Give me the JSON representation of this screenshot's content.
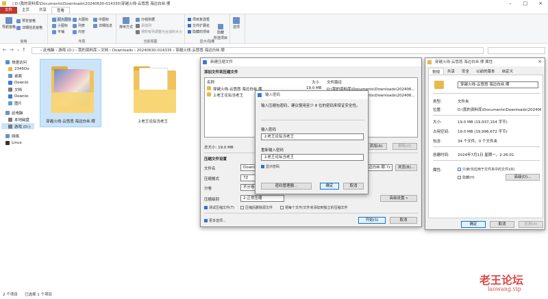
{
  "titlebar": {
    "title": "| D:\\我的资料库\\Documents\\Downloads\\20240630-014335\\穿越火线-云悠悠 海边白丝.哪"
  },
  "ribbon": {
    "tabs": [
      "文件",
      "主页",
      "共享",
      "查看"
    ],
    "groups": [
      {
        "label": "窗格",
        "items": [
          "导航窗格",
          "预览窗格",
          "详细信息窗格"
        ]
      },
      {
        "label": "布局",
        "items": [
          "超大图标",
          "大图标",
          "中图标",
          "小图标",
          "列表",
          "详细信息",
          "平铺",
          "内容"
        ]
      },
      {
        "label": "当前视图",
        "items": [
          "排序方式",
          "分组依据",
          "添加列",
          "将所有列调整为合适的大小"
        ]
      },
      {
        "label": "显示/隐藏",
        "items": [
          "项目复选框",
          "文件扩展名",
          "隐藏的项目",
          "隐藏",
          "所选项目"
        ]
      },
      {
        "label": "",
        "items": [
          "选项"
        ]
      }
    ]
  },
  "address": {
    "path": "› 此电脑 › 游戏 (D:) › 我的资料库 › 文档 › Downloads › 20240630-014335 › 穿越火线-云悠悠 海边白丝.哪"
  },
  "nav": {
    "items": [
      "快速访问",
      "2345Do",
      "桌面",
      "Downlo",
      "文档",
      "Downlo",
      "图片",
      "此电脑",
      "本地磁盘",
      "游戏 (D:)",
      "网络",
      "Linux"
    ]
  },
  "files": [
    {
      "name": "穿越火线-云悠悠 海边白丝.哪"
    },
    {
      "name": "上老王论坛当老王"
    }
  ],
  "status": {
    "count": "2 个项目",
    "selected": "已选择 1 个项目"
  },
  "archive": {
    "title": "新建压缩文件",
    "section_add": "添加文件到压缩文件",
    "cols": [
      "名称",
      "大小",
      "文件路径"
    ],
    "rows": [
      {
        "name": "穿越火线-云悠悠 海边白丝.哪",
        "size": "19.0 MB",
        "path": "D:\\我的资料库\\Documents\\Downloads\\202406..."
      },
      {
        "name": "上老王论坛当老王",
        "size": "",
        "path": "D:\\我的资料库\\Documents\\Downloads\\202406..."
      }
    ],
    "total": "总大小: 19.0 MB",
    "add_btn": "添加(A)",
    "del_btn": "删除(D)",
    "section_settings": "压缩文件设置",
    "filename_label": "文件名",
    "filename_value": "Downloads",
    "filename_tail": "穿越火线-云悠悠 海边白丝.哪.7z",
    "browse_btn": "浏览(B)...",
    "format_label": "压缩格式",
    "format_value": "7Z",
    "split_label": "分卷",
    "split_value": "不分卷",
    "level_label": "压缩级别",
    "level_value": "2-正常压缩",
    "advanced_btn": "高级设置 »",
    "opt1": "测试压缩文件(T)",
    "opt2": "压缩后删除源文件",
    "opt3": "把每个文件/文件夹添加到独立的压缩文件",
    "more": "更多选项...",
    "ok_btn": "开始(S)",
    "cancel_btn": "取消"
  },
  "password": {
    "title": "输入密码",
    "hint": "输入压缩包密码，建议使用至少 8 位的密码来保证安全性。",
    "label1": "输入密码",
    "value1": "上老王论坛当老王",
    "label2": "重新输入密码",
    "value2": "上老王论坛当老王",
    "show": "显示密码",
    "manager_btn": "密码管理器...",
    "ok_btn": "确定",
    "cancel_btn": "取消"
  },
  "props": {
    "title": "穿越火线-云悠悠 海边白丝.哪 属性",
    "tabs": [
      "常规",
      "共享",
      "安全",
      "以前的版本",
      "自定义"
    ],
    "name": "穿越火线-云悠悠 海边白丝.哪",
    "rows": [
      {
        "k": "类型:",
        "v": "文件夹"
      },
      {
        "k": "位置:",
        "v": "D:\\我的资料库\\Documents\\Downloads\\20240630-("
      },
      {
        "k": "大小:",
        "v": "19.0 MB (19,937,154 字节)"
      },
      {
        "k": "占用空间:",
        "v": "19.0 MB (19,996,672 字节)"
      },
      {
        "k": "包含:",
        "v": "34 个文件，0 个文件夹"
      },
      {
        "k": "创建时间:",
        "v": "2024年7月1日 星期一，2:26:01"
      }
    ],
    "attr_label": "属性:",
    "readonly": "只读(仅应用于文件夹中的文件)(R)",
    "hidden": "隐藏(H)",
    "advanced_btn": "高级(D)...",
    "ok_btn": "确定",
    "cancel_btn": "取消",
    "apply_btn": "应用(A)"
  },
  "watermark": {
    "text": "老王论坛",
    "url": "laowang.vip"
  }
}
